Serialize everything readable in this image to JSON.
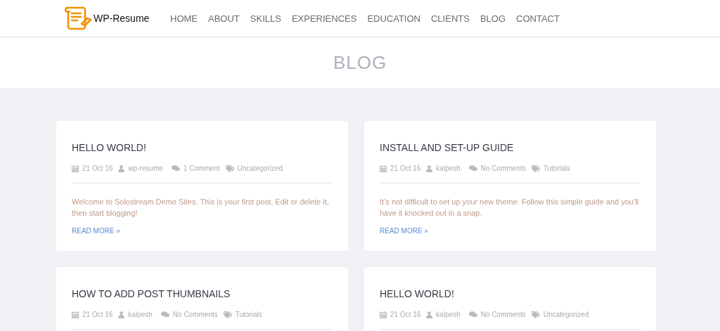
{
  "logo": {
    "text": "WP-Resume"
  },
  "nav": [
    "HOME",
    "ABOUT",
    "SKILLS",
    "EXPERIENCES",
    "EDUCATION",
    "CLIENTS",
    "BLOG",
    "CONTACT"
  ],
  "page_title": "BLOG",
  "posts": [
    {
      "title": "HELLO WORLD!",
      "date": "21 Oct 16",
      "author": "wp-resume",
      "comments": "1 Comment",
      "category": "Uncategorized",
      "excerpt": "Welcome to Solostream Demo Sites. This is your first post. Edit or delete it, then start blogging!",
      "read_more": "READ MORE »"
    },
    {
      "title": "INSTALL AND SET-UP GUIDE",
      "date": "21 Oct 16",
      "author": "kalpesh",
      "comments": "No Comments",
      "category": "Tutorials",
      "excerpt": "It’s not difficult to set up your new theme. Follow this simple guide and you’ll have it knocked out in a snap.",
      "read_more": "READ MORE »"
    },
    {
      "title": "HOW TO ADD POST THUMBNAILS",
      "date": "21 Oct 16",
      "author": "kalpesh",
      "comments": "No Comments",
      "category": "Tutorials"
    },
    {
      "title": "HELLO WORLD!",
      "date": "21 Oct 16",
      "author": "kalpesh",
      "comments": "No Comments",
      "category": "Uncategorized"
    }
  ]
}
